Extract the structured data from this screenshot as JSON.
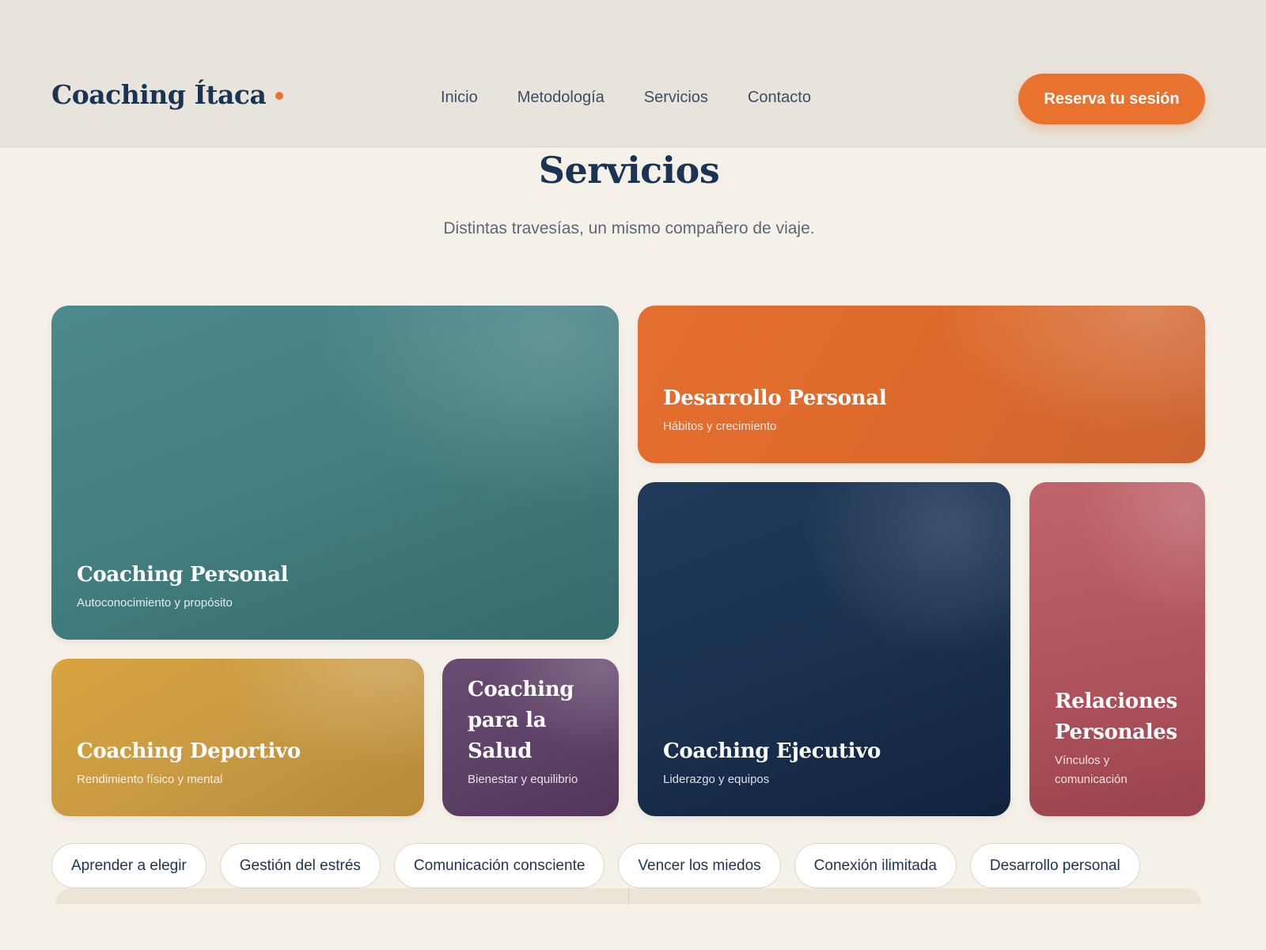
{
  "header": {
    "logo": "Coaching Ítaca",
    "nav": [
      "Inicio",
      "Metodología",
      "Servicios",
      "Contacto"
    ],
    "cta": "Reserva tu sesión",
    "accent_color": "#e9722f"
  },
  "section": {
    "title": "Servicios",
    "subtitle": "Distintas travesías, un mismo compañero de viaje."
  },
  "cards": {
    "personal": {
      "title": "Coaching Personal",
      "subtitle": "Autoconocimiento y propósito",
      "color": "#447e80"
    },
    "desarrollo": {
      "title": "Desarrollo Personal",
      "subtitle": "Hábitos y crecimiento",
      "color": "#dc6a2c"
    },
    "ejecutivo": {
      "title": "Coaching Ejecutivo",
      "subtitle": "Liderazgo y equipos",
      "color": "#1b3251"
    },
    "relaciones": {
      "title_line1": "Relaciones",
      "title_line2": "Personales",
      "subtitle_line1": "Vínculos y",
      "subtitle_line2": "comunicación",
      "color": "#b2555e"
    },
    "deportivo": {
      "title": "Coaching Deportivo",
      "subtitle": "Rendimiento físico y mental",
      "color": "#c99a44"
    },
    "salud": {
      "title_line1": "Coaching",
      "title_line2": "para la Salud",
      "subtitle": "Bienestar y equilibrio",
      "color": "#5f4268"
    }
  },
  "tags": [
    "Aprender a elegir",
    "Gestión del estrés",
    "Comunicación consciente",
    "Vencer los miedos",
    "Conexión ilimitada",
    "Desarrollo personal"
  ]
}
